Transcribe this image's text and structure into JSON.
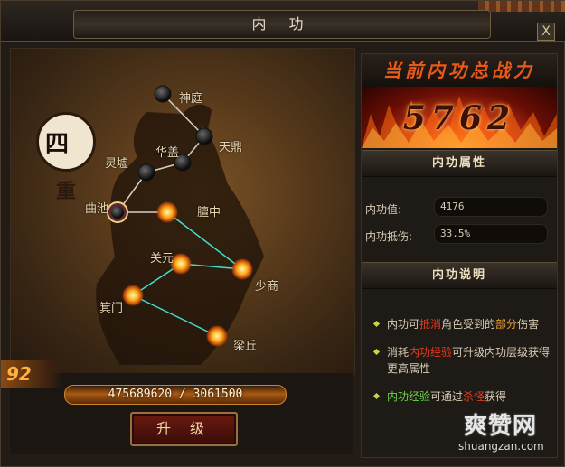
{
  "window": {
    "title": "内 功",
    "close_label": "X"
  },
  "rank": {
    "char1": "四",
    "char2": "重"
  },
  "meridian_nodes": [
    {
      "label": "神庭",
      "state": "locked"
    },
    {
      "label": "天鼎",
      "state": "locked"
    },
    {
      "label": "华盖",
      "state": "locked"
    },
    {
      "label": "灵墟",
      "state": "locked"
    },
    {
      "label": "曲池",
      "state": "current"
    },
    {
      "label": "膻中",
      "state": "active"
    },
    {
      "label": "关元",
      "state": "active"
    },
    {
      "label": "少商",
      "state": "active"
    },
    {
      "label": "箕门",
      "state": "active"
    },
    {
      "label": "梁丘",
      "state": "active"
    }
  ],
  "side_number": "92",
  "experience": {
    "text": "475689620 / 3061500"
  },
  "upgrade_label": "升 级",
  "power": {
    "title": "当前内功总战力",
    "value": "5762"
  },
  "attributes": {
    "section_title": "内功属性",
    "items": [
      {
        "label": "内功值:",
        "value": "4176"
      },
      {
        "label": "内功抵伤:",
        "value": "33.5%"
      }
    ]
  },
  "description": {
    "section_title": "内功说明",
    "lines": [
      {
        "segments": [
          {
            "t": "内功可",
            "c": "plain"
          },
          {
            "t": "抵消",
            "c": "red"
          },
          {
            "t": "角色受到的",
            "c": "plain"
          },
          {
            "t": "部分",
            "c": "orange"
          },
          {
            "t": "伤害",
            "c": "plain"
          }
        ]
      },
      {
        "segments": [
          {
            "t": "消耗",
            "c": "plain"
          },
          {
            "t": "内功经验",
            "c": "red"
          },
          {
            "t": "可升级内功层级获得更高属性",
            "c": "plain"
          }
        ]
      },
      {
        "segments": [
          {
            "t": "内功经验",
            "c": "green"
          },
          {
            "t": "可通过",
            "c": "plain"
          },
          {
            "t": "杀怪",
            "c": "red"
          },
          {
            "t": "获得",
            "c": "plain"
          }
        ]
      }
    ]
  },
  "watermark": {
    "logo": "爽赞网",
    "url": "shuangzan.com"
  },
  "colors": {
    "accent_orange": "#e85a1a",
    "node_glow": "#ffb020",
    "meridian_line": "#40e0d0",
    "highlight_red": "#e83a20",
    "highlight_green": "#6ad84a"
  }
}
